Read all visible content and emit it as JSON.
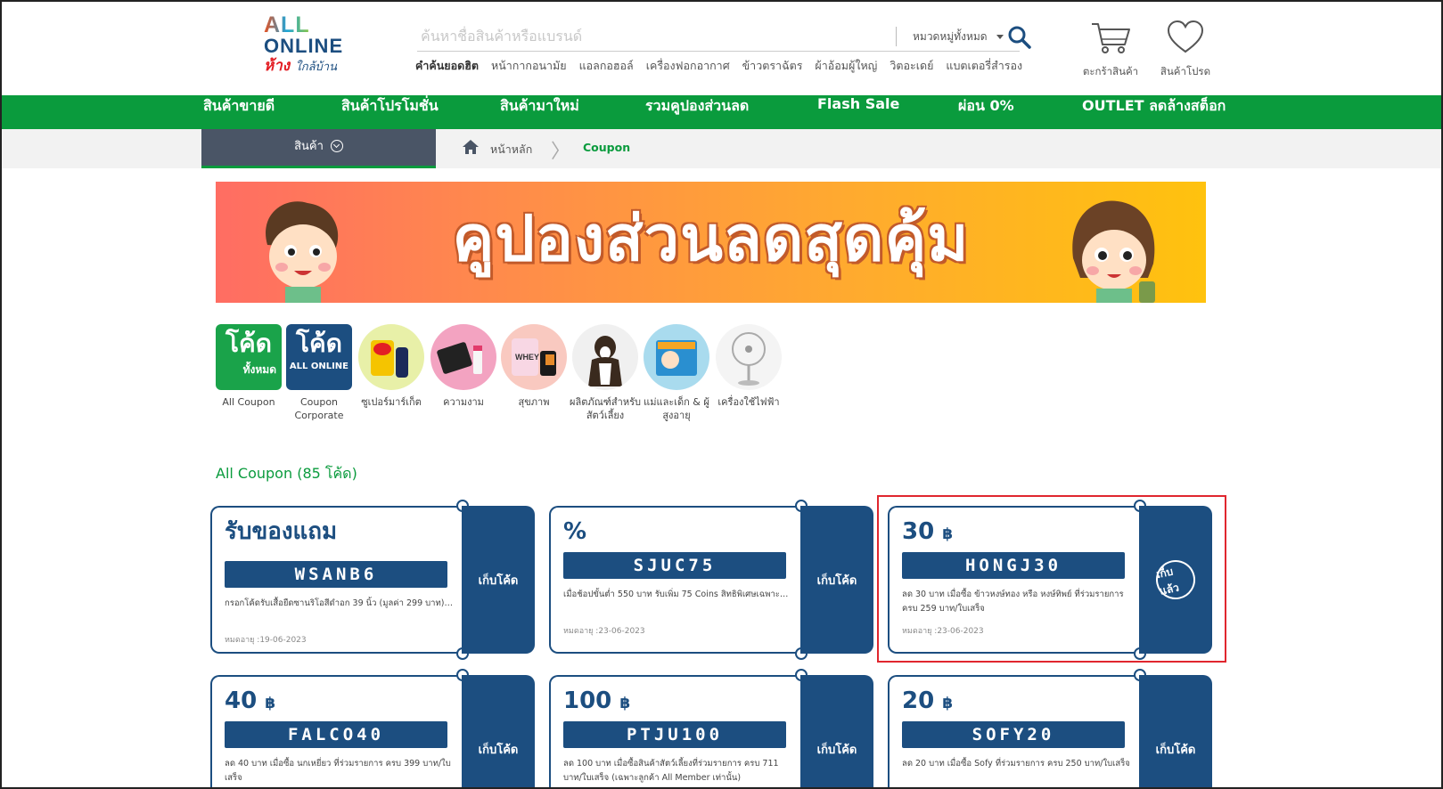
{
  "header": {
    "logo_line1": "ALL",
    "logo_line2": "ONLINE",
    "logo_line3a": "ห้าง",
    "logo_line3b": "ใกล้บ้าน",
    "search_placeholder": "ค้นหาชื่อสินค้าหรือแบรนด์",
    "category_select": "หมวดหมู่ทั้งหมด",
    "hot_title": "คำค้นยอดฮิต",
    "hot_words": [
      "หน้ากากอนามัย",
      "แอลกอฮอล์",
      "เครื่องฟอกอากาศ",
      "ข้าวตราฉัตร",
      "ผ้าอ้อมผู้ใหญ่",
      "วิตอะเดย์",
      "แบตเตอรี่สำรอง"
    ],
    "cart_label": "ตะกร้าสินค้า",
    "wishlist_label": "สินค้าโปรด"
  },
  "nav": [
    "สินค้าขายดี",
    "สินค้าโปรโมชั่น",
    "สินค้ามาใหม่",
    "รวมคูปองส่วนลด",
    "Flash Sale",
    "ผ่อน 0%",
    "OUTLET ลดล้างสต็อก"
  ],
  "breadcrumb": {
    "category_button": "สินค้า",
    "home": "หน้าหลัก",
    "current": "Coupon"
  },
  "banner": {
    "title": "คูปองส่วนลดสุดคุ้ม"
  },
  "categories": [
    {
      "label": "All Coupon",
      "pic_text": "โค้ด",
      "pic_sub": "ทั้งหมด"
    },
    {
      "label": "Coupon Corporate",
      "pic_text": "โค้ด",
      "pic_sub": "ALL ONLINE"
    },
    {
      "label": "ซูเปอร์มาร์เก็ต"
    },
    {
      "label": "ความงาม"
    },
    {
      "label": "สุขภาพ"
    },
    {
      "label": "ผลิตภัณฑ์สำหรับสัตว์เลี้ยง"
    },
    {
      "label": "แม่และเด็ก & ผู้สูงอายุ"
    },
    {
      "label": "เครื่องใช้ไฟฟ้า"
    }
  ],
  "coupon_section_title": "All Coupon (85 โค้ด)",
  "coupons": [
    {
      "head": "รับของแถม",
      "currency": "",
      "code": "WSANB6",
      "desc": "กรอกโค้ดรับเสื้อยืดซานริโอสีดำอก 39 นิ้ว (มูลค่า 299 บาท) ...",
      "expiry": "หมดอายุ :19-06-2023",
      "action": "เก็บโค้ด"
    },
    {
      "head": "%",
      "currency": "",
      "code": "SJUC75",
      "desc": "เมื่อช้อปขั้นต่ำ 550 บาท รับเพิ่ม 75 Coins สิทธิพิเศษเฉพาะลู...",
      "expiry": "หมดอายุ :23-06-2023",
      "action": "เก็บโค้ด"
    },
    {
      "head": "30",
      "currency": "฿",
      "code": "HONGJ30",
      "desc": "ลด 30 บาท เมื่อซื้อ ข้าวหงษ์ทอง หรือ หงษ์ทิพย์ ที่ร่วมรายการ ครบ 259 บาท/ใบเสร็จ",
      "expiry": "หมดอายุ :23-06-2023",
      "action": "เก็บแล้ว"
    },
    {
      "head": "40",
      "currency": "฿",
      "code": "FALCO40",
      "desc": "ลด 40 บาท เมื่อซื้อ นกเหยี่ยว ที่ร่วมรายการ ครบ 399 บาท/ใบเสร็จ",
      "expiry": "",
      "action": "เก็บโค้ด"
    },
    {
      "head": "100",
      "currency": "฿",
      "code": "PTJU100",
      "desc": "ลด 100 บาท เมื่อซื้อสินค้าสัตว์เลี้ยงที่ร่วมรายการ ครบ 711 บาท/ใบเสร็จ (เฉพาะลูกค้า All Member เท่านั้น)",
      "expiry": "",
      "action": "เก็บโค้ด"
    },
    {
      "head": "20",
      "currency": "฿",
      "code": "SOFY20",
      "desc": "ลด 20 บาท เมื่อซื้อ Sofy ที่ร่วมรายการ ครบ 250 บาท/ใบเสร็จ",
      "expiry": "",
      "action": "เก็บโค้ด"
    }
  ]
}
